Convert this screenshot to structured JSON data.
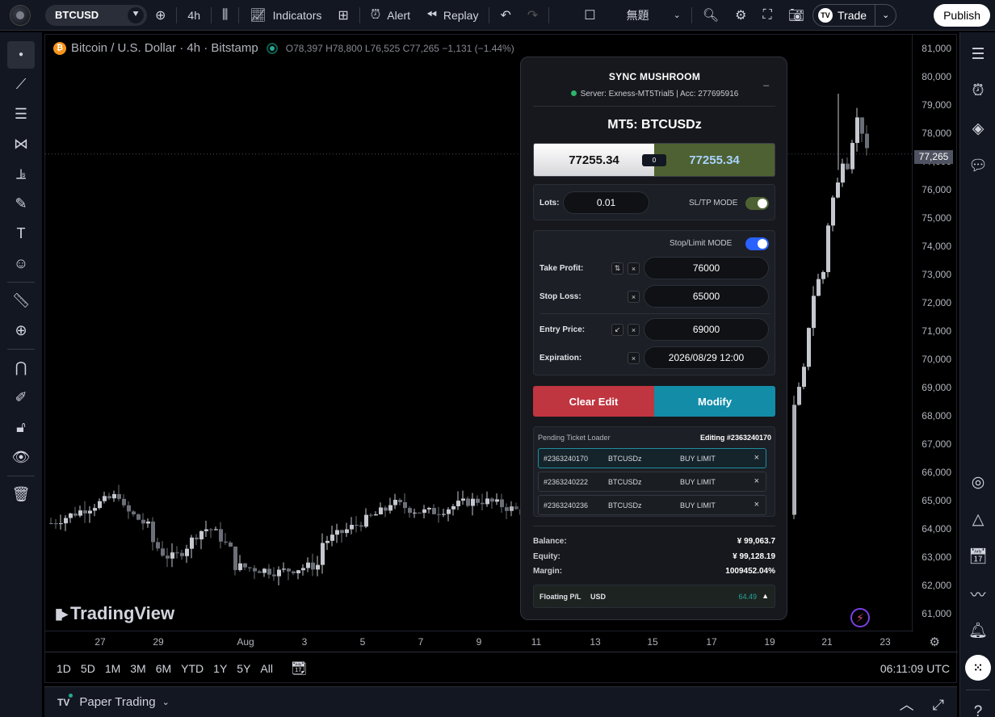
{
  "topbar": {
    "symbol": "BTCUSD",
    "interval": "4h",
    "indicators": "Indicators",
    "alert": "Alert",
    "replay": "Replay",
    "layout_name": "無題",
    "trade": "Trade",
    "publish": "Publish"
  },
  "legend": {
    "title": "Bitcoin / U.S. Dollar · 4h · Bitstamp",
    "open": "O78,397",
    "high": "H78,800",
    "low": "L76,525",
    "close": "C77,265",
    "change": "−1,131 (−1.44%)"
  },
  "price_scale": {
    "ticks": [
      "81,000",
      "80,000",
      "79,000",
      "78,000",
      "77,000",
      "76,000",
      "75,000",
      "74,000",
      "73,000",
      "72,000",
      "71,000",
      "70,000",
      "69,000",
      "68,000",
      "67,000",
      "66,000",
      "65,000",
      "64,000",
      "63,000",
      "62,000",
      "61,000"
    ],
    "last_price": "77,265"
  },
  "time_scale": {
    "ticks": [
      "27",
      "29",
      "Aug",
      "3",
      "5",
      "7",
      "9",
      "11",
      "13",
      "15",
      "17",
      "19",
      "21",
      "23"
    ]
  },
  "ranges": [
    "1D",
    "5D",
    "1M",
    "3M",
    "6M",
    "YTD",
    "1Y",
    "5Y",
    "All"
  ],
  "clock": "06:11:09 UTC",
  "watermark": "TradingView",
  "paper_trading": "Paper Trading",
  "panel": {
    "title": "SYNC MUSHROOM",
    "minimize": "_",
    "server": "Server: Exness-MT5Trial5 | Acc: 277695916",
    "symbol": "MT5: BTCUSDz",
    "bid": "77255.34",
    "ask": "77255.34",
    "spread": "0",
    "lots_label": "Lots:",
    "lots_value": "0.01",
    "sltp_mode": "SL/TP MODE",
    "stop_limit_mode": "Stop/Limit MODE",
    "take_profit_label": "Take Profit:",
    "take_profit": "76000",
    "stop_loss_label": "Stop Loss:",
    "stop_loss": "65000",
    "entry_price_label": "Entry Price:",
    "entry_price": "69000",
    "expiration_label": "Expiration:",
    "expiration": "2026/08/29 12:00",
    "clear_edit": "Clear Edit",
    "modify": "Modify",
    "pending_loader": "Pending Ticket Loader",
    "editing": "Editing #2363240170",
    "tickets": [
      {
        "id": "#2363240170",
        "symbol": "BTCUSDz",
        "type": "BUY LIMIT",
        "close": "×"
      },
      {
        "id": "#2363240222",
        "symbol": "BTCUSDz",
        "type": "BUY LIMIT",
        "close": "×"
      },
      {
        "id": "#2363240236",
        "symbol": "BTCUSDz",
        "type": "BUY LIMIT",
        "close": "×"
      }
    ],
    "balance_label": "Balance:",
    "balance": "¥ 99,063.7",
    "equity_label": "Equity:",
    "equity": "¥ 99,128.19",
    "margin_label": "Margin:",
    "margin": "1009452.04%",
    "floating_label": "Floating P/L",
    "floating_currency": "USD",
    "floating_value": "64.49",
    "floating_toggle": "▲"
  },
  "colors": {
    "bull": "#c6c8cf",
    "bear": "#6b6f78",
    "ask_bg": "#4e6132",
    "clear": "#bf3540",
    "modify": "#138ca8",
    "toggle_green": "#4e6132",
    "toggle_blue": "#2962ff"
  }
}
